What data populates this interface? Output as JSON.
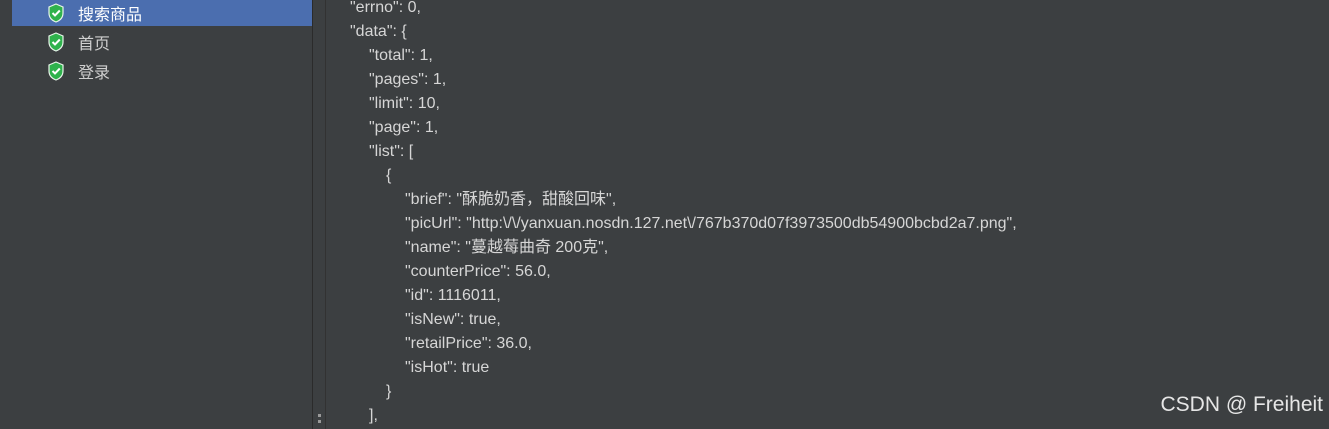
{
  "tree": {
    "items": [
      {
        "label": "搜索商品",
        "selected": true
      },
      {
        "label": "首页",
        "selected": false
      },
      {
        "label": "登录",
        "selected": false
      }
    ],
    "status_icon": "green-shield-check-icon"
  },
  "response_lines": [
    "\"errno\": 0,",
    "\"data\": {",
    "\"total\": 1,",
    "\"pages\": 1,",
    "\"limit\": 10,",
    "\"page\": 1,",
    "\"list\": [",
    "{",
    "\"brief\": \"酥脆奶香，甜酸回味\",",
    "\"picUrl\": \"http:\\/\\/yanxuan.nosdn.127.net\\/767b370d07f3973500db54900bcbd2a7.png\",",
    "\"name\": \"蔓越莓曲奇 200克\",",
    "\"counterPrice\": 56.0,",
    "\"id\": 1116011,",
    "\"isNew\": true,",
    "\"retailPrice\": 36.0,",
    "\"isHot\": true",
    "}",
    "],"
  ],
  "watermark": "CSDN @ Freiheit",
  "colors": {
    "background": "#3c3f41",
    "selection": "#4b6eaf",
    "icon_green": "#2fb24c"
  }
}
